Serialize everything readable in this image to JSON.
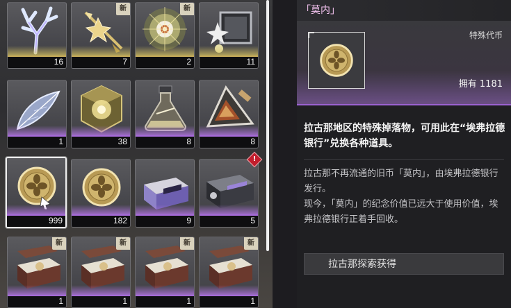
{
  "inventory": {
    "items": [
      {
        "name": "coral-crystal",
        "count": "16",
        "rarity": "gold",
        "new": false
      },
      {
        "name": "golden-star-spear",
        "count": "7",
        "rarity": "gold",
        "new": true
      },
      {
        "name": "radiant-shell",
        "count": "2",
        "rarity": "gold",
        "new": true
      },
      {
        "name": "steel-box-star",
        "count": "11",
        "rarity": "gold",
        "new": false
      },
      {
        "name": "crystal-leaf",
        "count": "1",
        "rarity": "purple",
        "new": false
      },
      {
        "name": "golden-cube",
        "count": "38",
        "rarity": "purple",
        "new": false
      },
      {
        "name": "glass-flask",
        "count": "8",
        "rarity": "purple",
        "new": false
      },
      {
        "name": "triangle-module",
        "count": "8",
        "rarity": "purple",
        "new": false
      },
      {
        "name": "monet-coin",
        "count": "999",
        "rarity": "purple",
        "new": false,
        "selected": true
      },
      {
        "name": "monet-coin",
        "count": "182",
        "rarity": "purple",
        "new": false
      },
      {
        "name": "supply-crate-purple",
        "count": "9",
        "rarity": "purple",
        "new": false
      },
      {
        "name": "dark-supply-crate",
        "count": "5",
        "rarity": "purple",
        "new": false,
        "alert": "!"
      },
      {
        "name": "treasure-chest",
        "count": "1",
        "rarity": "purple",
        "new": true
      },
      {
        "name": "treasure-chest",
        "count": "1",
        "rarity": "purple",
        "new": true
      },
      {
        "name": "treasure-chest",
        "count": "1",
        "rarity": "purple",
        "new": true
      },
      {
        "name": "treasure-chest",
        "count": "1",
        "rarity": "purple",
        "new": true
      }
    ],
    "new_label": "新",
    "alert_label": "!"
  },
  "detail": {
    "title": "「莫内」",
    "type": "特殊代币",
    "owned": "拥有 1181",
    "summary": "拉古那地区的特殊掉落物，可用此在“埃弗拉德银行”兑换各种道具。",
    "lore": "拉古那不再流通的旧币「莫内」，由埃弗拉德银行发行。\n现今，「莫内」的纪念价值已远大于使用价值，埃弗拉德银行正着手回收。",
    "source": "拉古那探索获得"
  },
  "colors": {
    "gold_rarity": "#c5a958",
    "purple_rarity": "#a66ad8",
    "title_pink": "#f2c1ee",
    "alert_red": "#c21e2d"
  }
}
